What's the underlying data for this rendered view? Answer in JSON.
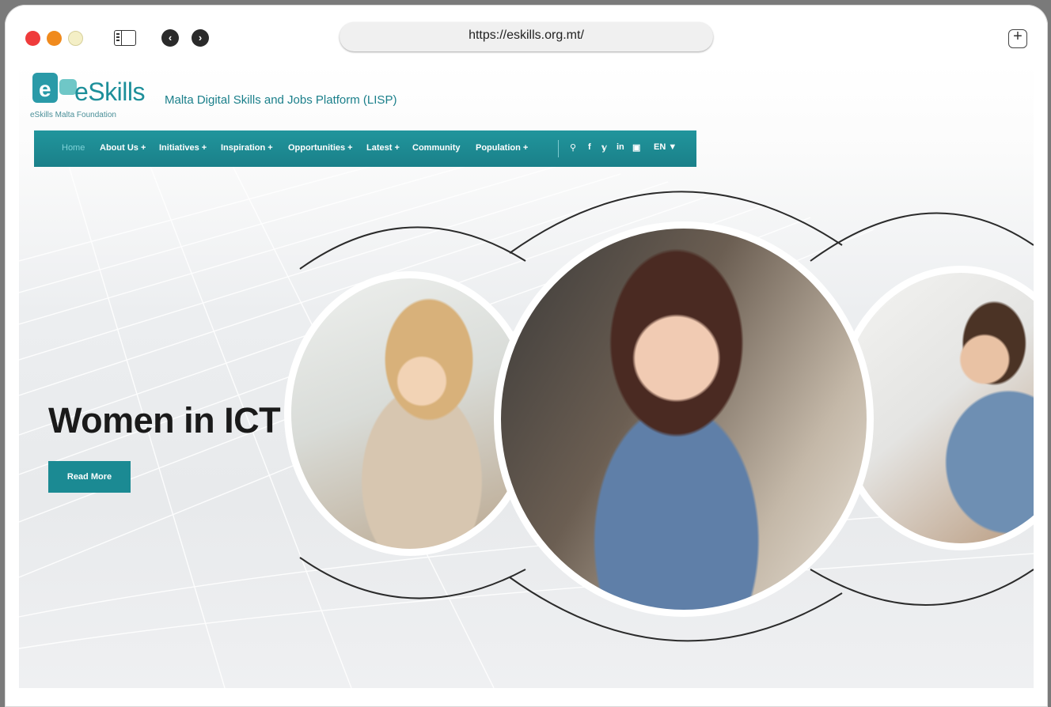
{
  "browser": {
    "url": "https://eskills.org.mt/",
    "back_icon": "‹",
    "forward_icon": "›",
    "new_tab_icon": "+"
  },
  "site": {
    "logo_word": "eSkills",
    "logo_subtitle": "eSkills Malta Foundation",
    "tagline": "Malta Digital Skills and Jobs Platform (LISP)"
  },
  "nav": {
    "items": [
      {
        "label": "Home"
      },
      {
        "label": "About Us +"
      },
      {
        "label": "Initiatives +"
      },
      {
        "label": "Inspiration +"
      },
      {
        "label": "Opportunities +"
      },
      {
        "label": "Latest +"
      },
      {
        "label": "Community"
      },
      {
        "label": "Population +"
      }
    ],
    "icons": {
      "search": "⚲",
      "facebook": "f",
      "twitter": "𝕪",
      "linkedin": "in",
      "youtube": "▣"
    },
    "language": "EN ▼"
  },
  "hero": {
    "title": "Women in ICT",
    "button_label": "Read More"
  },
  "colors": {
    "brand_teal": "#1b8a93",
    "hero_title": "#1a1a1a"
  }
}
